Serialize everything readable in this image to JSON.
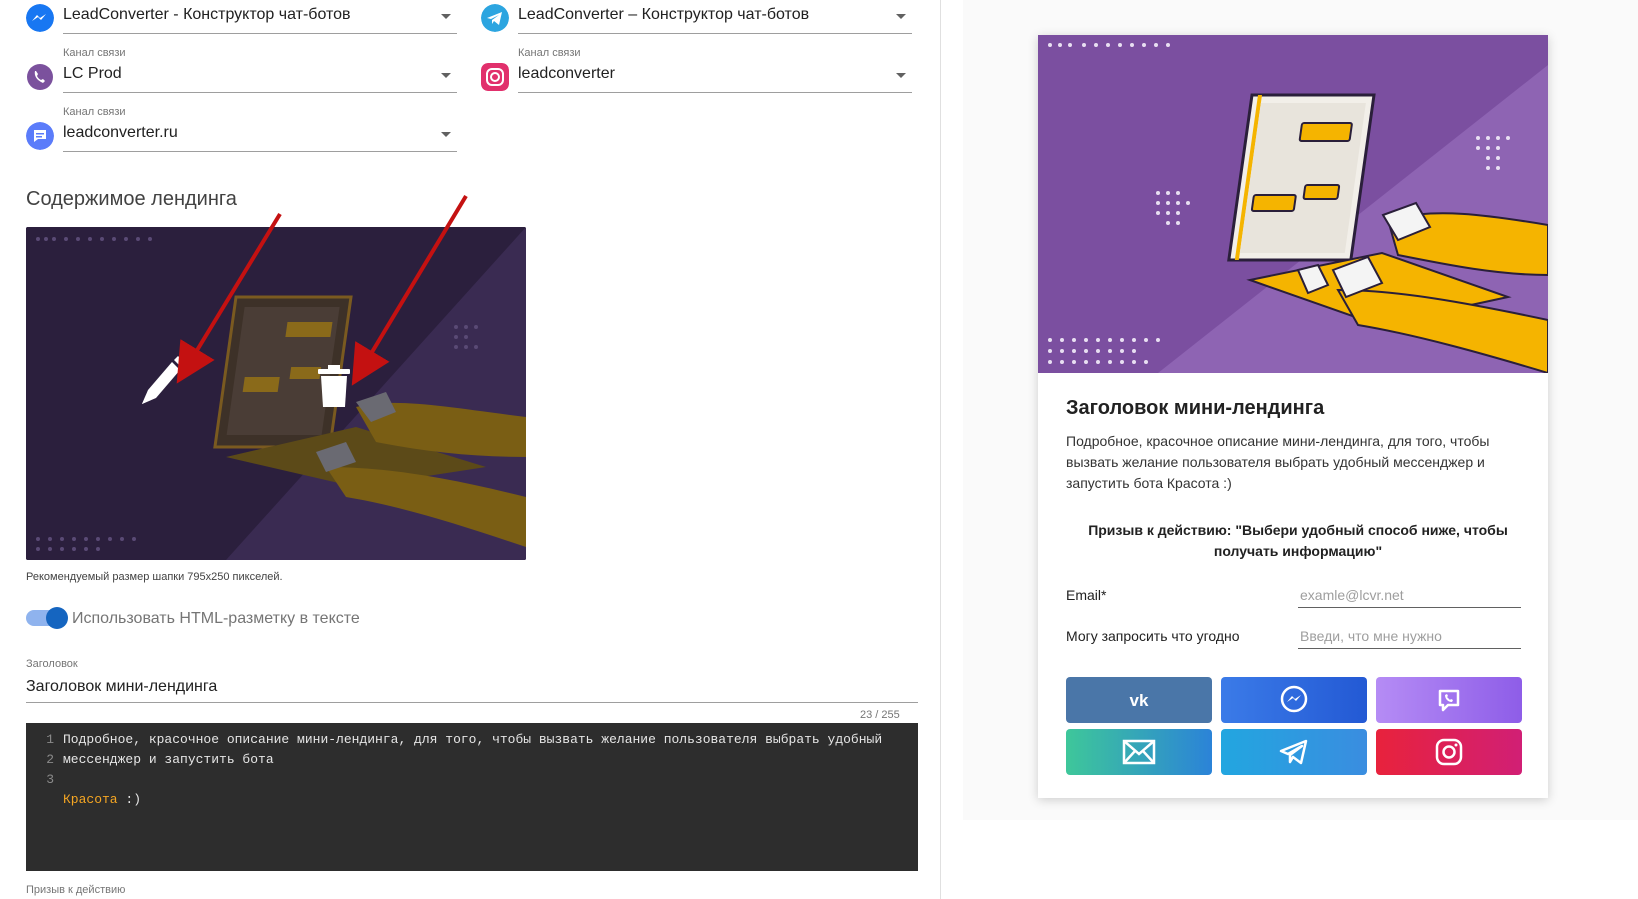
{
  "channels": {
    "field_label": "Канал связи",
    "items": [
      {
        "name": "messenger",
        "value": "LeadConverter - Конструктор чат-ботов",
        "icon": "messenger-icon",
        "color": "#1877f2"
      },
      {
        "name": "telegram",
        "value": "LeadConverter – Конструктор чат-ботов",
        "icon": "telegram-icon",
        "color": "#2ca5e0"
      },
      {
        "name": "viber",
        "value": "LC Prod",
        "icon": "viber-icon",
        "color": "#7b519d"
      },
      {
        "name": "instagram",
        "value": "leadconverter",
        "icon": "instagram-icon",
        "color": "#e1306c"
      },
      {
        "name": "widget",
        "value": "leadconverter.ru",
        "icon": "chat-bubble-icon",
        "color": "#5b7cfa"
      }
    ]
  },
  "content": {
    "section_title": "Содержимое лендинга",
    "header_hint": "Рекомендуемый размер шапки 795х250 пикселей.",
    "edit_icon": "pencil-icon",
    "delete_icon": "trash-icon"
  },
  "html_toggle": {
    "label": "Использовать HTML-разметку в тексте",
    "checked": true
  },
  "title_field": {
    "label": "Заголовок",
    "value": "Заголовок мини-лендинга",
    "counter": "23 / 255"
  },
  "editor": {
    "line_numbers": [
      "1",
      "2",
      "3"
    ],
    "line1": "Подробное, красочное описание мини-лендинга, для того, чтобы вызвать желание пользователя выбрать удобный",
    "line2": "мессенджер и запустить бота",
    "line3_highlight": "Красота",
    "line3_rest": " :)"
  },
  "cta_field": {
    "label": "Призыв к действию"
  },
  "preview": {
    "title": "Заголовок мини-лендинга",
    "description": "Подробное, красочное описание мини-лендинга, для того, чтобы вызвать желание пользователя выбрать удобный мессенджер и запустить бота Красота :)",
    "cta": "Призыв к действию: \"Выбери удобный способ ниже, чтобы получать информацию\"",
    "email_label": "Email*",
    "email_placeholder": "examle@lcvr.net",
    "request_label": "Могу запросить что угодно",
    "request_placeholder": "Введи, что мне нужно",
    "buttons": [
      {
        "name": "vk",
        "icon": "vk-icon",
        "color": "#4a76a8"
      },
      {
        "name": "messenger",
        "icon": "messenger-icon",
        "color": "#2f6be8"
      },
      {
        "name": "viber",
        "icon": "viber-icon",
        "color": "#9b6cf0"
      },
      {
        "name": "email",
        "icon": "envelope-icon",
        "color": "#35b6a0"
      },
      {
        "name": "telegram",
        "icon": "telegram-icon",
        "color": "#2ca5e0"
      },
      {
        "name": "instagram",
        "icon": "instagram-icon",
        "color": "#e1306c"
      }
    ]
  }
}
